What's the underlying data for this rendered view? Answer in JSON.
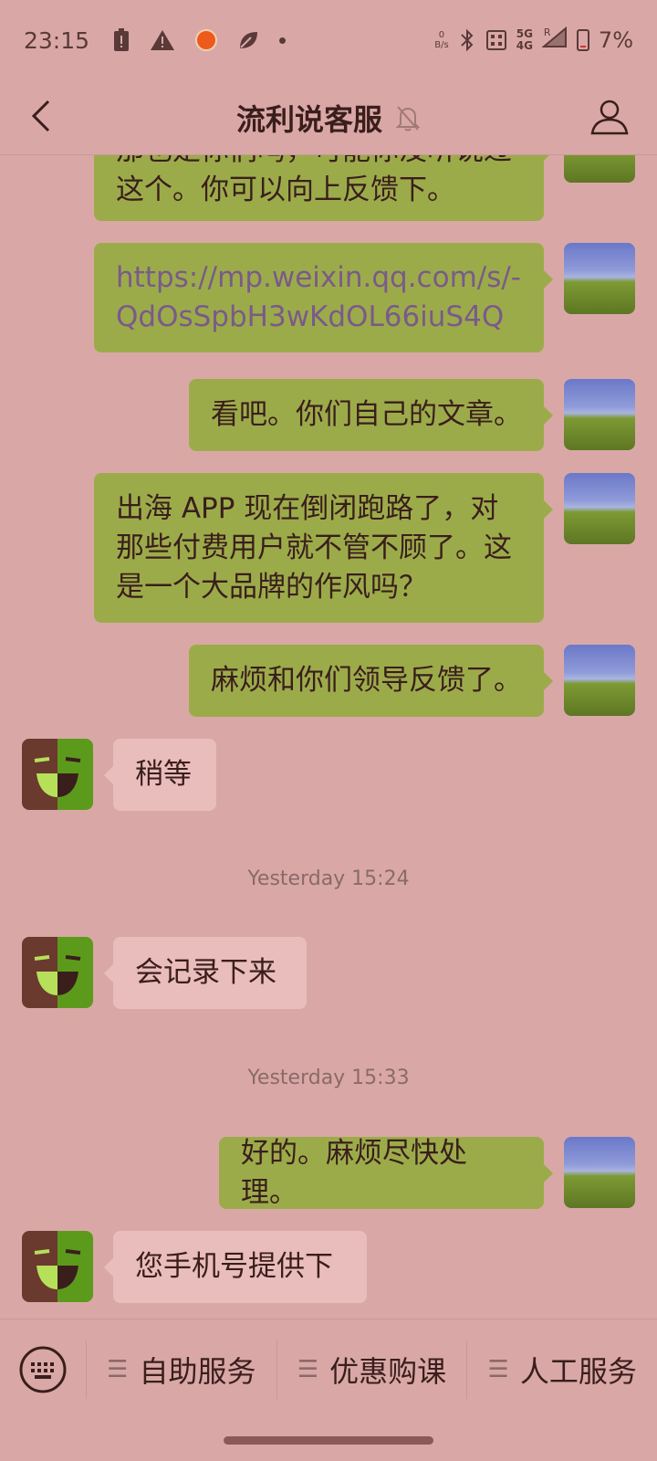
{
  "status_bar": {
    "time": "23:15",
    "net_speed_value": "0",
    "net_speed_unit": "B/s",
    "network_top": "5G",
    "network_bottom": "4G",
    "roaming": "R",
    "battery": "7%"
  },
  "header": {
    "title": "流利说客服",
    "muted": true
  },
  "messages": [
    {
      "sender": "me",
      "text": "那也是你们吗，可能你没听说过这个。你可以向上反馈下。",
      "line1": "那也是你们吗，可能你没听说过",
      "line2": "这个。你可以向上反馈下。"
    },
    {
      "sender": "me",
      "type": "link",
      "line1": "https://mp.weixin.qq.com/s/-",
      "line2": "QdOsSpbH3wKdOL66iuS4Q"
    },
    {
      "sender": "me",
      "text": "看吧。你们自己的文章。"
    },
    {
      "sender": "me",
      "line1": "出海 APP 现在倒闭跑路了，对",
      "line2": "那些付费用户就不管不顾了。这",
      "line3": "是一个大品牌的作风吗？"
    },
    {
      "sender": "me",
      "text": "麻烦和你们领导反馈了。"
    },
    {
      "sender": "them",
      "text": "稍等"
    },
    {
      "type": "timestamp",
      "text": "Yesterday 15:24"
    },
    {
      "sender": "them",
      "text": "会记录下来"
    },
    {
      "type": "timestamp",
      "text": "Yesterday 15:33"
    },
    {
      "sender": "me",
      "text": "好的。麻烦尽快处理。"
    },
    {
      "sender": "them",
      "text": "您手机号提供下"
    }
  ],
  "bottom_menu": {
    "items": [
      "自助服务",
      "优惠购课",
      "人工服务"
    ]
  },
  "colors": {
    "background": "#d9a8a6",
    "my_bubble": "#9cab4a",
    "their_bubble": "#e9bdbb",
    "link_text": "#7a5a8a"
  }
}
